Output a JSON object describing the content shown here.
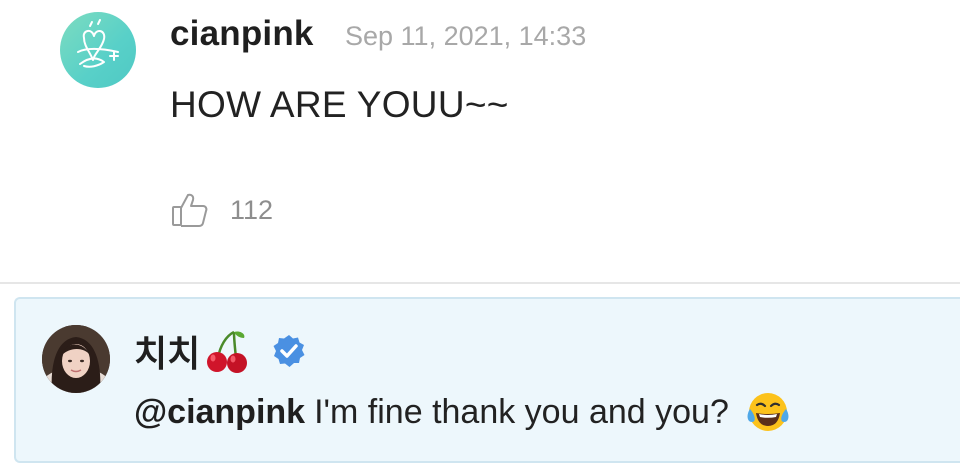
{
  "post": {
    "author": "cianpink",
    "timestamp": "Sep 11, 2021, 14:33",
    "body": "HOW ARE YOUU~~",
    "likes": "112"
  },
  "reply": {
    "author": "치치",
    "author_emoji_icon": "cherry-icon",
    "verified_icon": "verified-badge-icon",
    "mention": "@cianpink",
    "text": "I'm fine thank you and you?",
    "trailing_emoji_icon": "tears-of-joy-icon"
  },
  "colors": {
    "avatar_teal": "#58d0c8",
    "verified_blue": "#4a90e2",
    "reply_bg": "#edf7fc",
    "reply_border": "#cfe5f0",
    "timestamp_gray": "#a8a8a8"
  }
}
